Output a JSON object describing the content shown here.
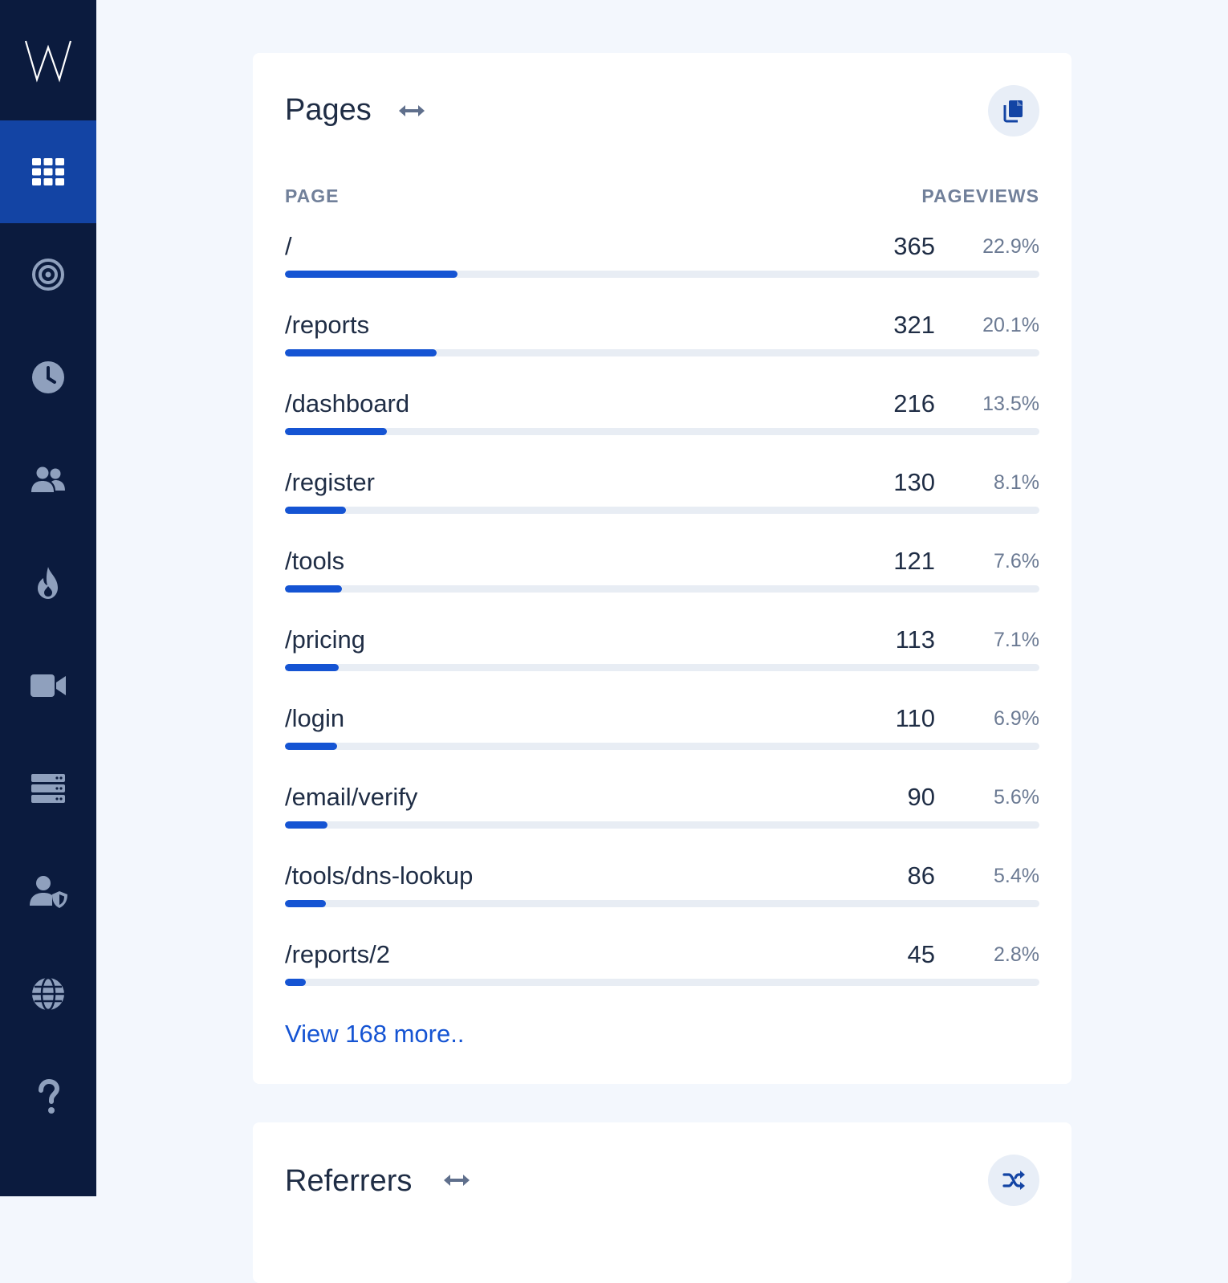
{
  "sidebar": {
    "logo": "W",
    "items": [
      {
        "icon": "grid-icon",
        "active": true
      },
      {
        "icon": "target-icon",
        "active": false
      },
      {
        "icon": "clock-icon",
        "active": false
      },
      {
        "icon": "users-icon",
        "active": false
      },
      {
        "icon": "fire-icon",
        "active": false
      },
      {
        "icon": "video-camera-icon",
        "active": false
      },
      {
        "icon": "server-icon",
        "active": false
      },
      {
        "icon": "user-shield-icon",
        "active": false
      },
      {
        "icon": "globe-icon",
        "active": false
      },
      {
        "icon": "question-icon",
        "active": false
      }
    ]
  },
  "pages_card": {
    "title": "Pages",
    "header_page": "PAGE",
    "header_pageviews": "PAGEVIEWS",
    "rows": [
      {
        "path": "/",
        "count": "365",
        "pct": "22.9%",
        "share": 0.229
      },
      {
        "path": "/reports",
        "count": "321",
        "pct": "20.1%",
        "share": 0.201
      },
      {
        "path": "/dashboard",
        "count": "216",
        "pct": "13.5%",
        "share": 0.135
      },
      {
        "path": "/register",
        "count": "130",
        "pct": "8.1%",
        "share": 0.081
      },
      {
        "path": "/tools",
        "count": "121",
        "pct": "7.6%",
        "share": 0.076
      },
      {
        "path": "/pricing",
        "count": "113",
        "pct": "7.1%",
        "share": 0.071
      },
      {
        "path": "/login",
        "count": "110",
        "pct": "6.9%",
        "share": 0.069
      },
      {
        "path": "/email/verify",
        "count": "90",
        "pct": "5.6%",
        "share": 0.056
      },
      {
        "path": "/tools/dns-lookup",
        "count": "86",
        "pct": "5.4%",
        "share": 0.054
      },
      {
        "path": "/reports/2",
        "count": "45",
        "pct": "2.8%",
        "share": 0.028
      }
    ],
    "more_link": "View 168 more.."
  },
  "referrers_card": {
    "title": "Referrers"
  },
  "colors": {
    "sidebar_bg": "#0b1b3e",
    "active_nav": "#1344a4",
    "accent": "#1554d3",
    "page_bg": "#f3f7fd"
  }
}
